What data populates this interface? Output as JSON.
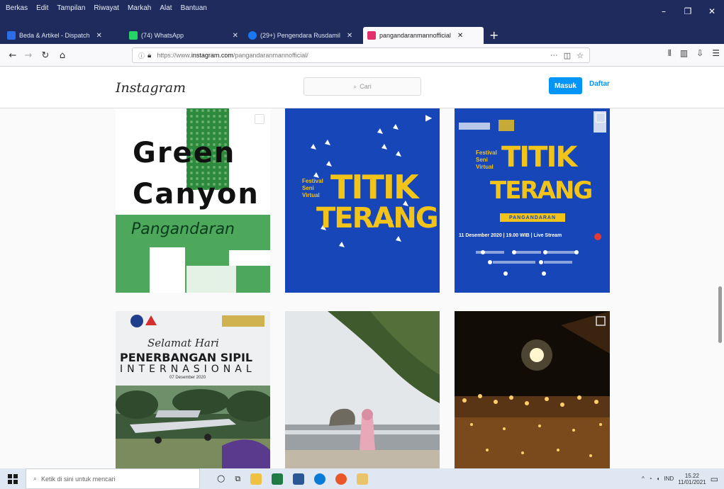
{
  "browser": {
    "menu": [
      "Berkas",
      "Edit",
      "Tampilan",
      "Riwayat",
      "Markah",
      "Alat",
      "Bantuan"
    ],
    "tabs": [
      {
        "title": "Beda & Artikel - Dispatch",
        "favicon_color": "#2b6de6"
      },
      {
        "title": "(74) WhatsApp",
        "favicon_color": "#25d366"
      },
      {
        "title": "(29+) Pengendara Rusdamil",
        "favicon_color": "#1877f2"
      },
      {
        "title": "pangandaranmannofficial",
        "favicon_color": "#e1306c",
        "active": true
      }
    ],
    "url_prefix": "https://www.",
    "url_host": "instagram.com",
    "url_path": "/pangandaranmannofficial/",
    "url_ellipsis": "···",
    "window_controls": [
      "–",
      "❐",
      "✕"
    ]
  },
  "instagram": {
    "logo": "Instagram",
    "search_placeholder": "Cari",
    "login_label": "Masuk",
    "signup_label": "Daftar"
  },
  "posts": {
    "p1": {
      "line1": "Green",
      "line2": "Canyon",
      "line3": "Pangandaran"
    },
    "p2": {
      "title1": "TITIK",
      "title2": "TERANG",
      "sub": "Festival Seni Virtual"
    },
    "p3": {
      "title1": "TITIK",
      "title2": "TERANG",
      "sub": "Festival Seni Virtual",
      "venue": "PANGANDARAN",
      "info": "11 Desember 2020 | 19.00 WIB | Live Stream"
    },
    "p4": {
      "top": "Selamat Hari",
      "main": "PENERBANGAN SIPIL",
      "main2": "INTERNASIONAL",
      "date": "07 Desember 2020"
    }
  },
  "taskbar": {
    "search_placeholder": "Ketik di sini untuk mencari",
    "time": "15.22",
    "date": "11/01/2021",
    "lang": "IND"
  }
}
